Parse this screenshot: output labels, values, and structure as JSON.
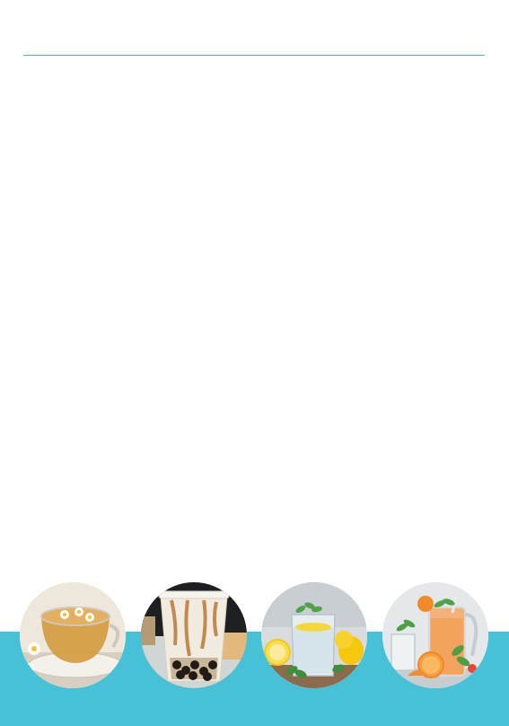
{
  "document": {
    "theme": {
      "rule_color": "#5fa9cf",
      "band_color": "#46c1d6",
      "background": "#ffffff"
    },
    "photos": [
      {
        "icon": "chamomile-tea-icon",
        "subject": "chamomile-tea"
      },
      {
        "icon": "bubble-tea-icon",
        "subject": "bubble-milk-tea"
      },
      {
        "icon": "lemon-water-icon",
        "subject": "lemon-mint-water"
      },
      {
        "icon": "orange-drink-icon",
        "subject": "orange-iced-drink"
      }
    ]
  }
}
